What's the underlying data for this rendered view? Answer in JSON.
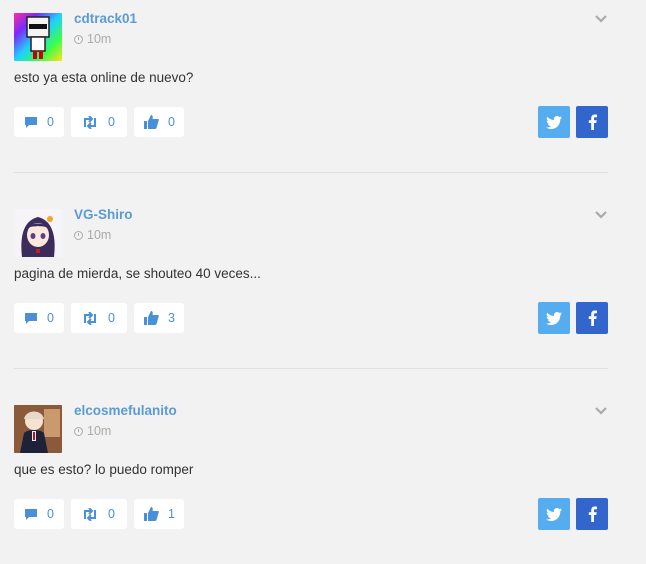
{
  "posts": [
    {
      "username": "cdtrack01",
      "time": "10m",
      "message": "esto ya esta online de nuevo?",
      "comments": "0",
      "reposts": "0",
      "likes": "0",
      "avatar": "rainbow-avatar"
    },
    {
      "username": "VG-Shiro",
      "time": "10m",
      "message": "pagina de mierda, se shouteo 40 veces...",
      "comments": "0",
      "reposts": "0",
      "likes": "3",
      "avatar": "anime-girl-avatar"
    },
    {
      "username": "elcosmefulanito",
      "time": "10m",
      "message": "que es esto? lo puedo romper",
      "comments": "0",
      "reposts": "0",
      "likes": "1",
      "avatar": "character-avatar"
    }
  ],
  "colors": {
    "accent": "#5b9bd5",
    "twitter": "#55acee",
    "facebook": "#3366cc",
    "background": "#f2f2f2"
  },
  "icons": {
    "comment": "comment-icon",
    "repost": "repost-icon",
    "like": "thumbs-up-icon",
    "clock": "clock-icon",
    "chevron": "chevron-down-icon",
    "twitter": "twitter-icon",
    "facebook": "facebook-icon"
  }
}
